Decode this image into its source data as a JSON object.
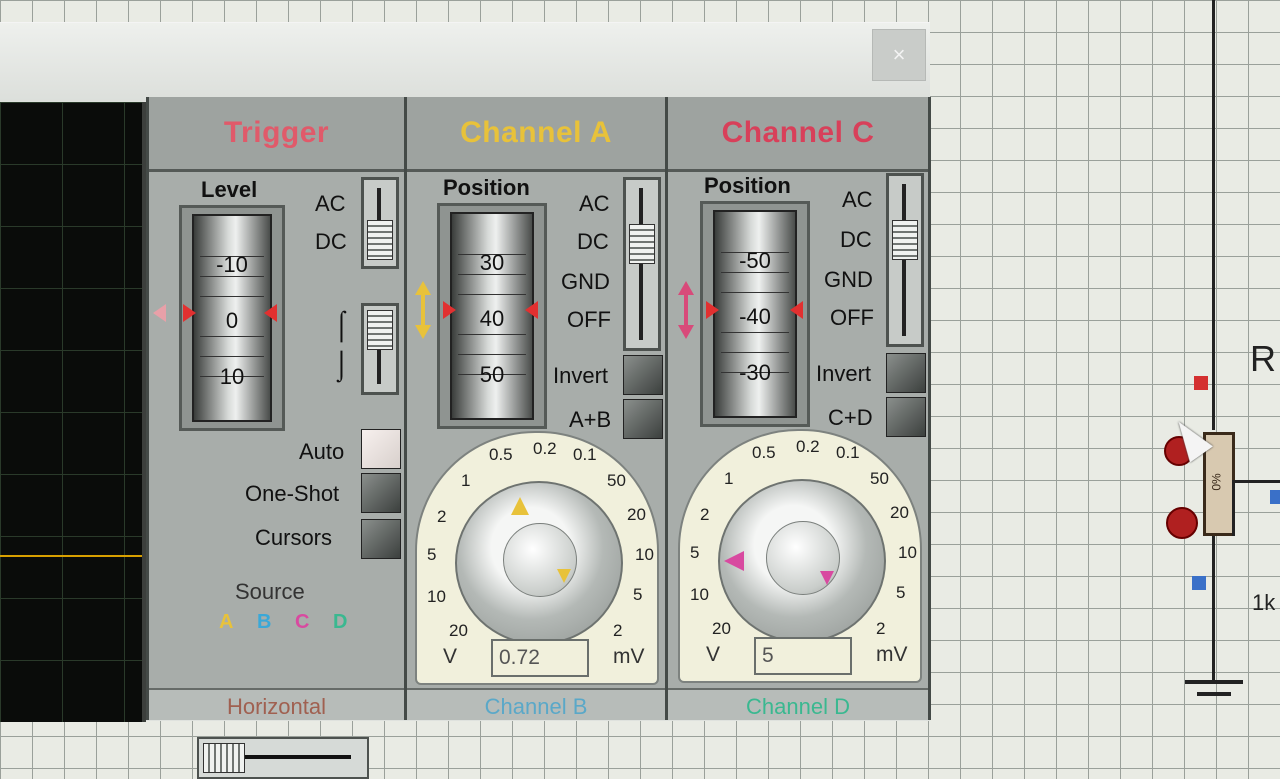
{
  "window": {
    "close_label": "×"
  },
  "trigger": {
    "title": "Trigger",
    "level_label": "Level",
    "ruler": [
      "-10",
      "0",
      "10"
    ],
    "coupling": [
      "AC",
      "DC"
    ],
    "edge_rising": "⌠",
    "edge_falling": "⌡",
    "auto_label": "Auto",
    "one_shot_label": "One-Shot",
    "cursors_label": "Cursors",
    "source_label": "Source",
    "sources": [
      "A",
      "B",
      "C",
      "D"
    ],
    "footer": "Horizontal"
  },
  "channel_a": {
    "title": "Channel A",
    "position_label": "Position",
    "ruler": [
      "30",
      "40",
      "50"
    ],
    "modes": [
      "AC",
      "DC",
      "GND",
      "OFF"
    ],
    "invert_label": "Invert",
    "combine_label": "A+B",
    "dial_left": [
      "0.5",
      "0.2",
      "0.1",
      "1",
      "2",
      "5",
      "10",
      "20"
    ],
    "dial_right": [
      "50",
      "20",
      "10",
      "5",
      "2"
    ],
    "unit_v": "V",
    "unit_mv": "mV",
    "value": "0.72",
    "footer": "Channel B"
  },
  "channel_c": {
    "title": "Channel C",
    "position_label": "Position",
    "ruler": [
      "-50",
      "-40",
      "-30"
    ],
    "modes": [
      "AC",
      "DC",
      "GND",
      "OFF"
    ],
    "invert_label": "Invert",
    "combine_label": "C+D",
    "dial_left": [
      "0.5",
      "0.2",
      "0.1",
      "1",
      "2",
      "5",
      "10",
      "20"
    ],
    "dial_right": [
      "50",
      "20",
      "10",
      "5",
      "2"
    ],
    "unit_v": "V",
    "unit_mv": "mV",
    "value": "5",
    "footer": "Channel D"
  },
  "schematic": {
    "component_ref": "R",
    "resistor_label": "0%",
    "value_label": "1k"
  },
  "colors": {
    "trigger_title": "#e05a6a",
    "channel_a_title": "#e8c23a",
    "channel_c_title": "#d8405a",
    "source_a": "#e8c23a",
    "source_b": "#3aa8d8",
    "source_c": "#d84aa0",
    "source_d": "#3ab890"
  }
}
